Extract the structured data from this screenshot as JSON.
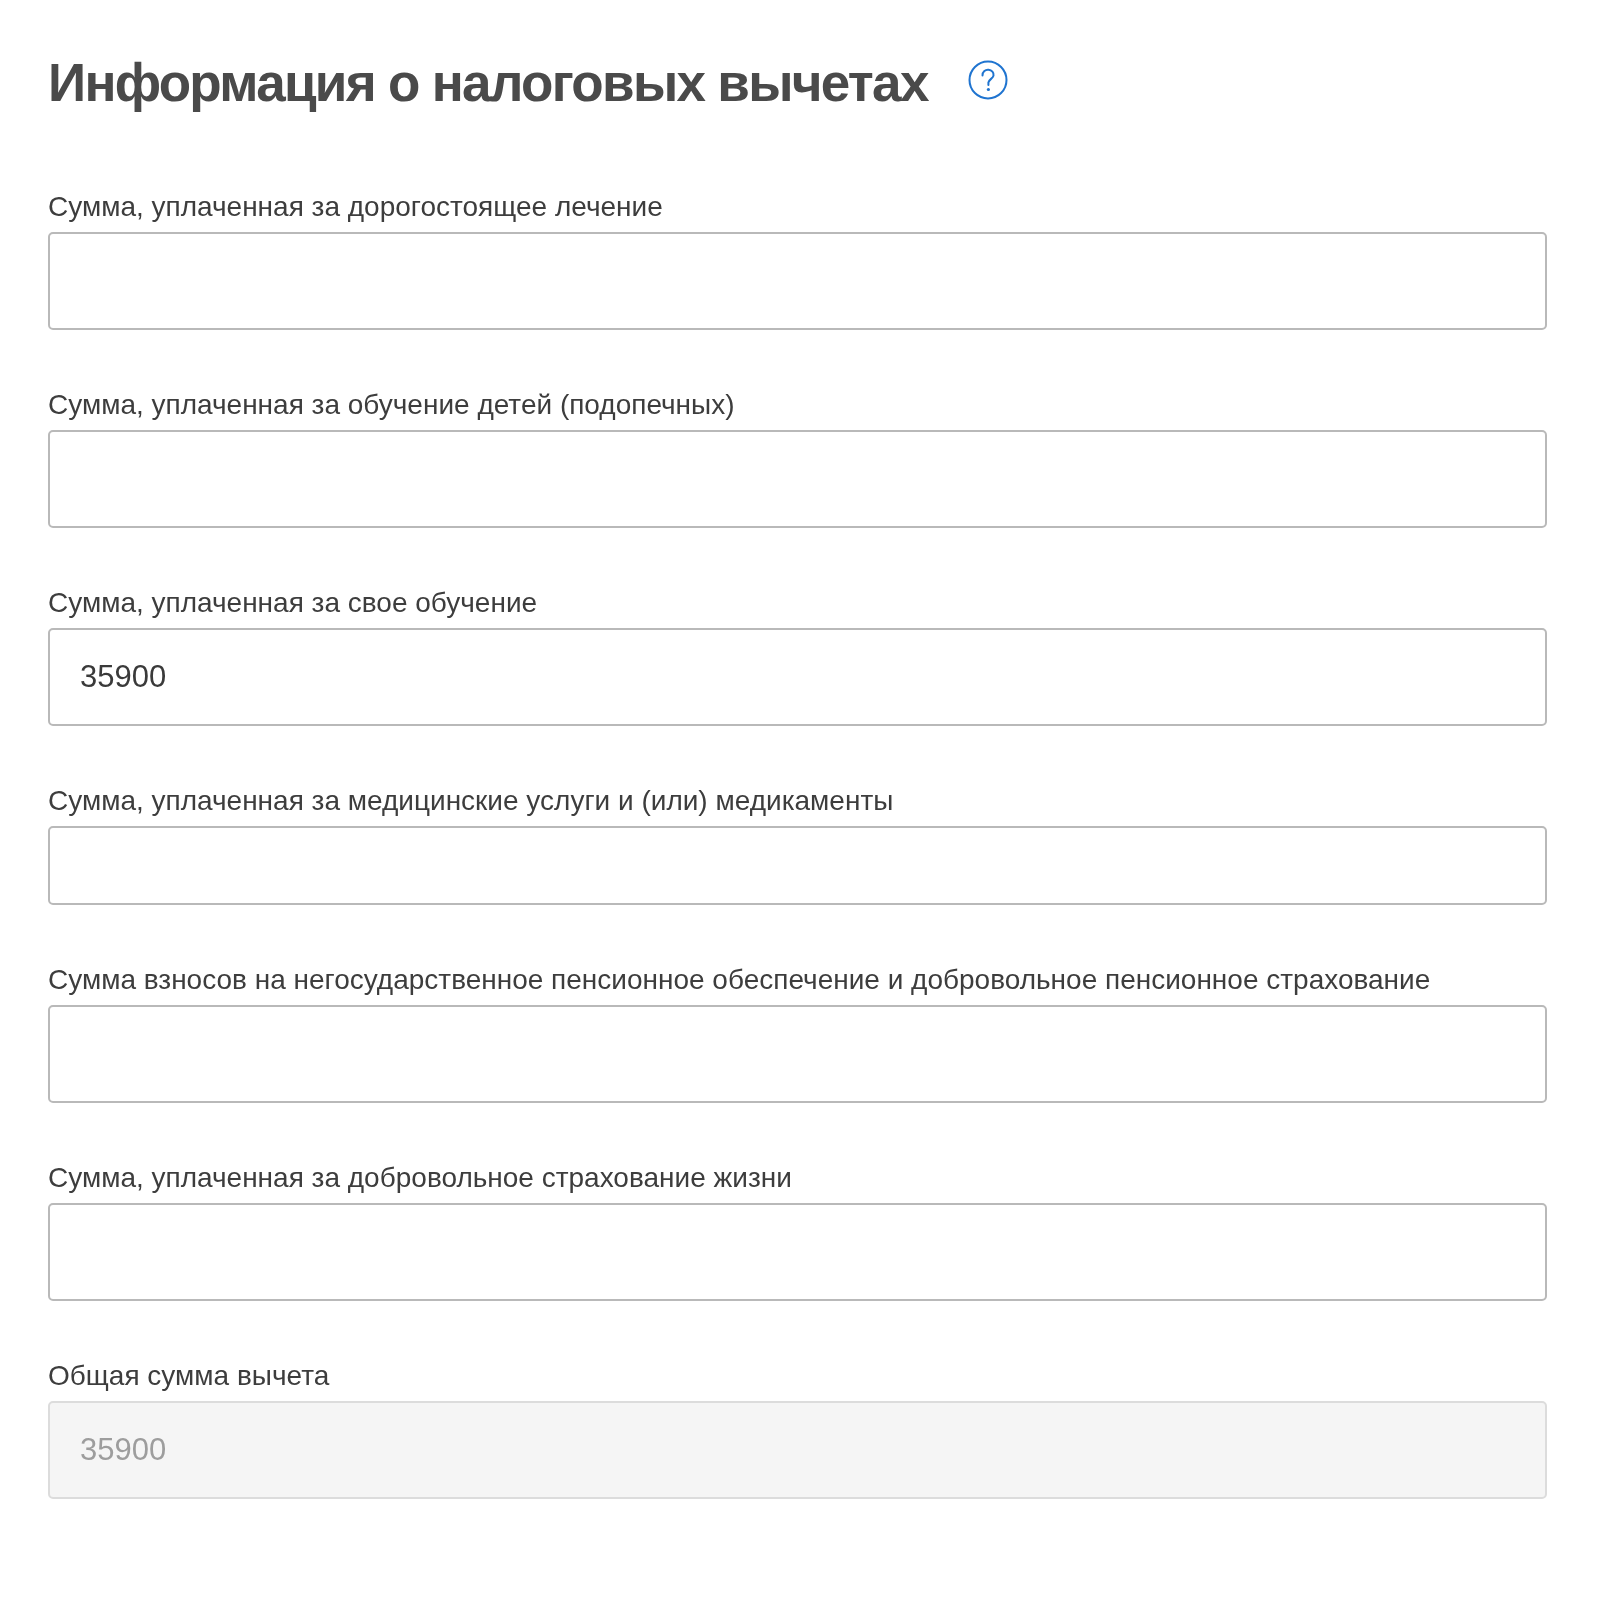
{
  "title": "Информация о налоговых вычетах",
  "fields": [
    {
      "label": "Сумма, уплаченная за дорогостоящее лечение",
      "disabled": false
    },
    {
      "label": "Сумма, уплаченная за обучение детей (подопечных)",
      "disabled": false
    },
    {
      "label": "Сумма, уплаченная за свое обучение",
      "value": "35900",
      "disabled": false
    },
    {
      "label": "Сумма, уплаченная за медицинские услуги и (или) медикаменты",
      "disabled": false
    },
    {
      "label": "Сумма взносов на негосударственное пенсионное обеспечение и добровольное пенсионное страхование",
      "disabled": false
    },
    {
      "label": "Сумма, уплаченная за добровольное страхование жизни",
      "disabled": false
    },
    {
      "label": "Общая сумма вычета",
      "value": "35900",
      "disabled": true
    }
  ]
}
